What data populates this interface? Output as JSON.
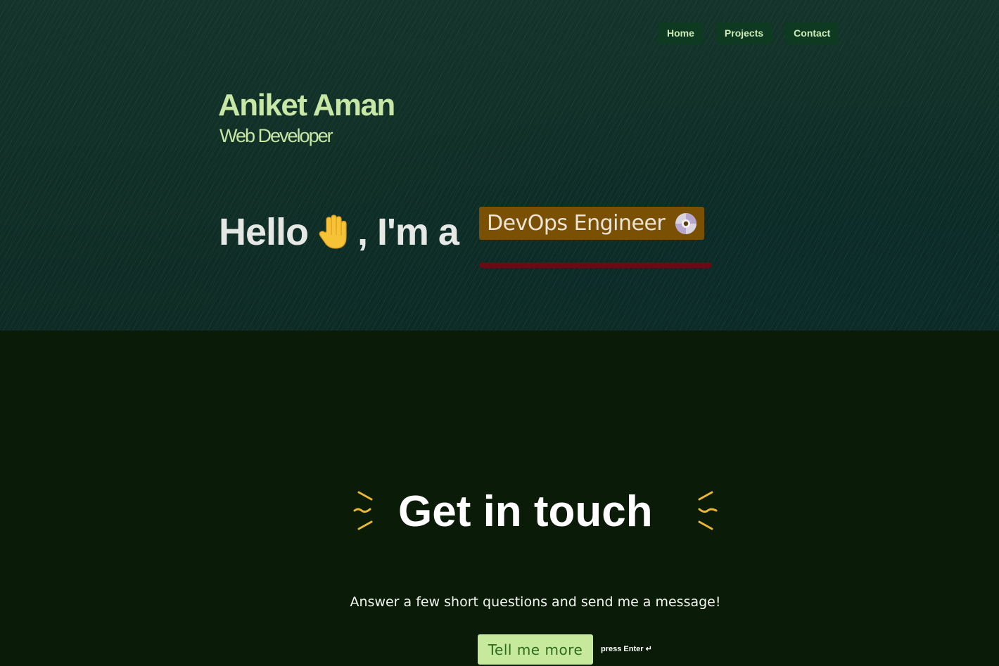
{
  "nav": {
    "items": [
      {
        "label": "Home"
      },
      {
        "label": "Projects"
      },
      {
        "label": "Contact"
      }
    ]
  },
  "hero": {
    "name": "Aniket Aman",
    "role": "Web Developer",
    "greeting_prefix": "Hello",
    "greeting_suffix": ", I'm a",
    "typed_text": "DevOps Engineer",
    "wave_icon": "waving-hand-icon",
    "typed_icon": "optical-disc-icon"
  },
  "contact": {
    "heading": "Get in touch",
    "subtitle": "Answer a few short questions and send me a message!",
    "cta_label": "Tell me more",
    "hint": "press Enter ↵"
  },
  "colors": {
    "accent_green": "#c6e7a6",
    "nav_bg": "#0e3a22",
    "typed_bg": "#7a5104",
    "underline": "#6a0a14",
    "spark": "#e9b731",
    "cta_bg": "#c7e99c"
  }
}
